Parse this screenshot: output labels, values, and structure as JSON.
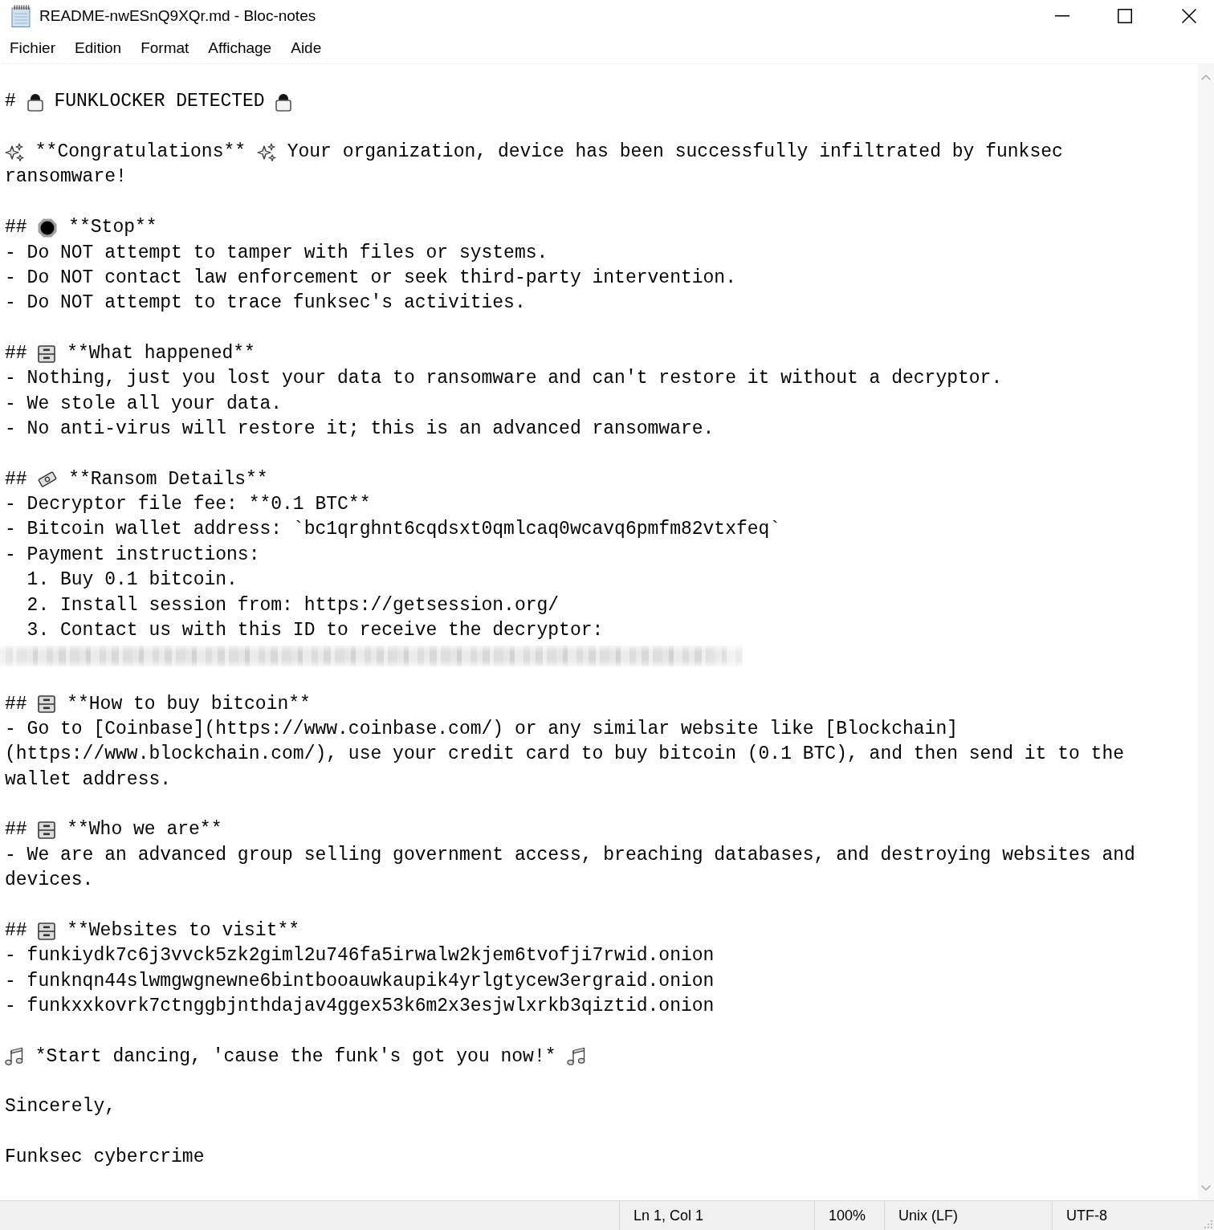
{
  "window": {
    "title": "README-nwESnQ9XQr.md - Bloc-notes"
  },
  "menu": [
    "Fichier",
    "Edition",
    "Format",
    "Affichage",
    "Aide"
  ],
  "note": {
    "title": [
      {
        "kind": "text",
        "text": "#"
      },
      {
        "kind": "lock"
      },
      {
        "kind": "text",
        "text": "FUNKLOCKER DETECTED"
      },
      {
        "kind": "lock"
      }
    ],
    "intro": [
      [
        {
          "kind": "sparkle"
        },
        {
          "kind": "text",
          "text": "**Congratulations**"
        },
        {
          "kind": "sparkle"
        },
        {
          "kind": "text",
          "text": "Your organization, device has been successfully infiltrated by funksec"
        }
      ],
      [
        {
          "kind": "text",
          "text": "ransomware!"
        }
      ]
    ],
    "sections": [
      {
        "heading": [
          {
            "kind": "text",
            "text": "##"
          },
          {
            "kind": "stop"
          },
          {
            "kind": "text",
            "text": "**Stop**"
          }
        ],
        "items": [
          {
            "text": "- Do NOT attempt to tamper with files or systems."
          },
          {
            "text": "- Do NOT contact law enforcement or seek third-party intervention."
          },
          {
            "text": "- Do NOT attempt to trace funksec's activities."
          }
        ]
      },
      {
        "heading": [
          {
            "kind": "text",
            "text": "##"
          },
          {
            "kind": "cabinet"
          },
          {
            "kind": "text",
            "text": "**What happened**"
          }
        ],
        "items": [
          {
            "text": "- Nothing, just you lost your data to ransomware and can't restore it without a decryptor."
          },
          {
            "text": "- We stole all your data."
          },
          {
            "text": "- No anti-virus will restore it; this is an advanced ransomware."
          }
        ]
      },
      {
        "heading": [
          {
            "kind": "text",
            "text": "##"
          },
          {
            "kind": "banknote"
          },
          {
            "kind": "text",
            "text": "**Ransom Details**"
          }
        ],
        "items": [
          {
            "text": "- Decryptor file fee: **0.1 BTC**"
          },
          {
            "text": "- Bitcoin wallet address: `bc1qrghnt6cqdsxt0qmlcaq0wcavq6pmfm82vtxfeq`"
          },
          {
            "text": "- Payment instructions:",
            "children": [
              {
                "text": "1. Buy 0.1 bitcoin."
              },
              {
                "text": "2. Install session from: https://getsession.org/"
              },
              {
                "text": "3. Contact us with this ID to receive the decryptor:"
              }
            ]
          }
        ],
        "redacted_line": true
      },
      {
        "heading": [
          {
            "kind": "text",
            "text": "##"
          },
          {
            "kind": "cabinet"
          },
          {
            "kind": "text",
            "text": "**How to buy bitcoin**"
          }
        ],
        "items": [
          {
            "text": "- Go to [Coinbase](https://www.coinbase.com/) or any similar website like [Blockchain](https://www.blockchain.com/), use your credit card to buy bitcoin (0.1 BTC), and then send it to the wallet address."
          }
        ]
      },
      {
        "heading": [
          {
            "kind": "text",
            "text": "##"
          },
          {
            "kind": "cabinet"
          },
          {
            "kind": "text",
            "text": "**Who we are**"
          }
        ],
        "items": [
          {
            "text": "- We are an advanced group selling government access, breaching databases, and destroying websites and devices."
          }
        ]
      },
      {
        "heading": [
          {
            "kind": "text",
            "text": "##"
          },
          {
            "kind": "cabinet"
          },
          {
            "kind": "text",
            "text": "**Websites to visit**"
          }
        ],
        "items": [
          {
            "text": "- funkiydk7c6j3vvck5zk2giml2u746fa5irwalw2kjem6tvofji7rwid.onion"
          },
          {
            "text": "- funknqn44slwmgwgnewne6bintbooauwkaupik4yrlgtycew3ergraid.onion"
          },
          {
            "text": "- funkxxkovrk7ctnggbjnthdajav4ggex53k6m2x3esjwlxrkb3qiztid.onion"
          }
        ]
      }
    ],
    "closing": [
      {
        "kind": "notes"
      },
      {
        "kind": "text",
        "text": "*Start dancing, 'cause the funk's got you now!*"
      },
      {
        "kind": "notes"
      }
    ],
    "signoff": [
      "Sincerely,",
      "Funksec cybercrime"
    ]
  },
  "status_bar": {
    "cursor": "Ln 1, Col 1",
    "zoom": "100%",
    "line_ending": "Unix (LF)",
    "encoding": "UTF-8"
  }
}
